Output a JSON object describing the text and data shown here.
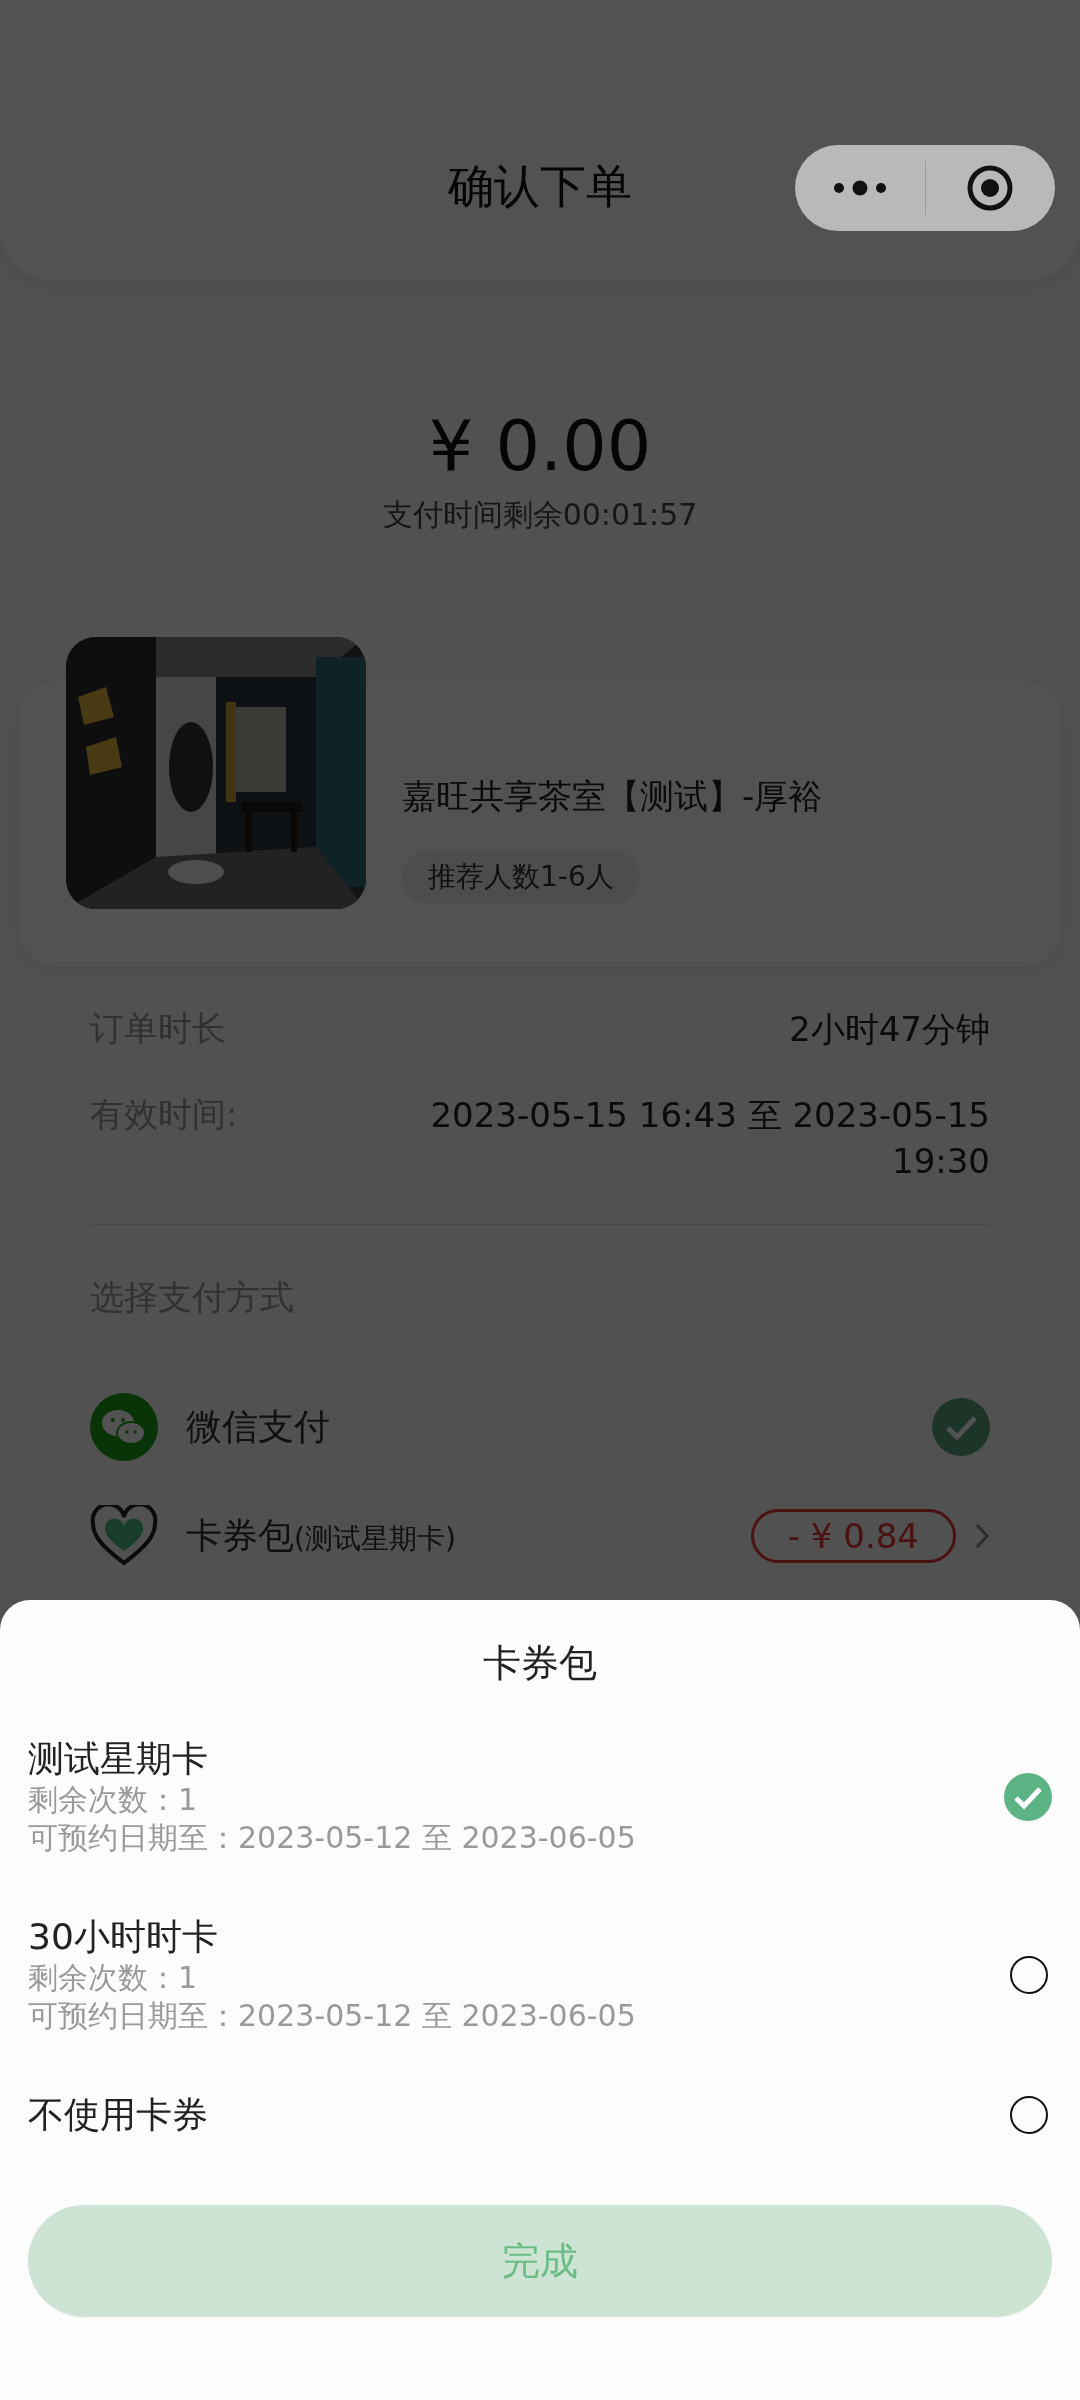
{
  "nav": {
    "title": "确认下单"
  },
  "payment_summary": {
    "amount": "¥ 0.00",
    "countdown": "支付时间剩余00:01:57"
  },
  "room": {
    "name": "嘉旺共享茶室【测试】-厚裕",
    "tag": "推荐人数1-6人"
  },
  "details": [
    {
      "label": "订单时长",
      "value": "2小时47分钟"
    },
    {
      "label": "有效时间:",
      "value": "2023-05-15 16:43 至 2023-05-15 19:30"
    }
  ],
  "payment": {
    "heading": "选择支付方式",
    "methods": [
      {
        "kind": "wechat",
        "label": "微信支付",
        "selected": true
      },
      {
        "kind": "coupon",
        "label": "卡券包",
        "note": "(测试星期卡)",
        "discount": "- ¥ 0.84"
      }
    ]
  },
  "coupon_sheet": {
    "title": "卡券包",
    "options": [
      {
        "name": "测试星期卡",
        "remaining": "剩余次数：1",
        "validity": "可预约日期至：2023-05-12 至 2023-06-05",
        "selected": true
      },
      {
        "name": "30小时时卡",
        "remaining": "剩余次数：1",
        "validity": "可预约日期至：2023-05-12 至 2023-06-05",
        "selected": false
      },
      {
        "name": "不使用卡券",
        "selected": false
      }
    ],
    "done_button": "完成"
  }
}
